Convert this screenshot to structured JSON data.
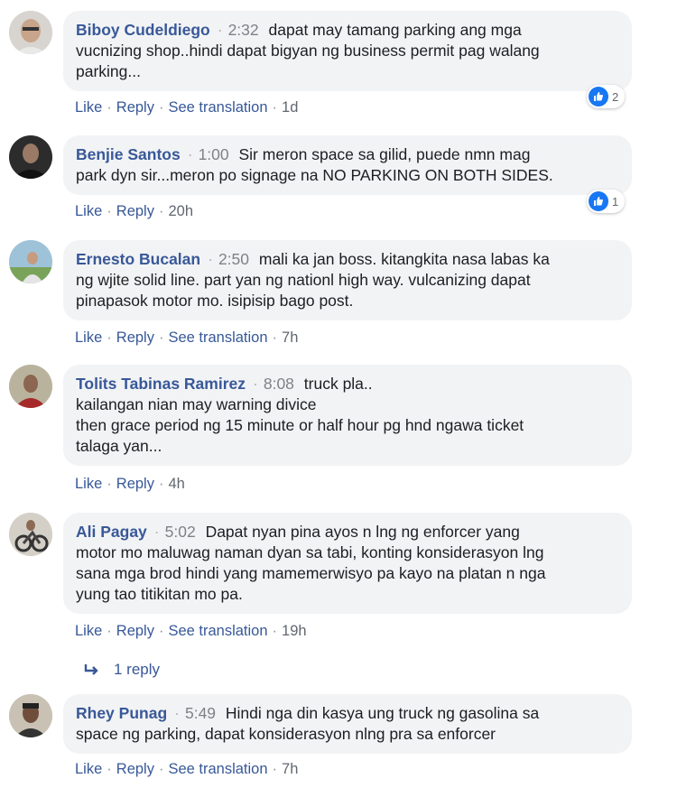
{
  "colors": {
    "link": "#385898",
    "bubble": "#f2f3f5",
    "like_badge": "#1877f2"
  },
  "comments": [
    {
      "author": "Biboy Cudeldiego",
      "time": "2:32",
      "lines": [
        "dapat may tamang parking ang mga",
        "vucnizing shop..hindi dapat bigyan ng business permit pag walang",
        "parking..."
      ],
      "actions": [
        "Like",
        "Reply",
        "See translation"
      ],
      "age": "1d",
      "reactions": "2"
    },
    {
      "author": "Benjie Santos",
      "time": "1:00",
      "lines": [
        "Sir meron space sa gilid, puede nmn mag",
        "park dyn sir...meron po signage na NO PARKING ON BOTH SIDES."
      ],
      "actions": [
        "Like",
        "Reply"
      ],
      "age": "20h",
      "reactions": "1"
    },
    {
      "author": "Ernesto Bucalan",
      "time": "2:50",
      "lines": [
        "mali ka jan boss. kitangkita nasa labas ka",
        "ng wjite solid line. part yan ng nationl high way. vulcanizing dapat",
        "pinapasok motor mo. isipisip bago post."
      ],
      "actions": [
        "Like",
        "Reply",
        "See translation"
      ],
      "age": "7h"
    },
    {
      "author": "Tolits Tabinas Ramirez",
      "time": "8:08",
      "lines": [
        "truck pla..",
        "kailangan nian may warning divice",
        "then grace period ng 15 minute or half hour pg hnd ngawa ticket",
        "talaga yan..."
      ],
      "actions": [
        "Like",
        "Reply"
      ],
      "age": "4h"
    },
    {
      "author": "Ali Pagay",
      "time": "5:02",
      "lines": [
        "Dapat nyan pina ayos n lng ng enforcer yang",
        "motor mo maluwag naman dyan sa tabi, konting konsiderasyon lng",
        "sana mga brod hindi yang mamemerwisyo pa kayo na platan n nga",
        "yung tao titikitan mo pa."
      ],
      "actions": [
        "Like",
        "Reply",
        "See translation"
      ],
      "age": "19h",
      "replies": "1 reply"
    },
    {
      "author": "Rhey Punag",
      "time": "5:49",
      "lines": [
        "Hindi nga din kasya ung truck ng gasolina sa",
        "space ng parking, dapat konsiderasyon nlng pra sa enforcer"
      ],
      "actions": [
        "Like",
        "Reply",
        "See translation"
      ],
      "age": "7h"
    }
  ]
}
